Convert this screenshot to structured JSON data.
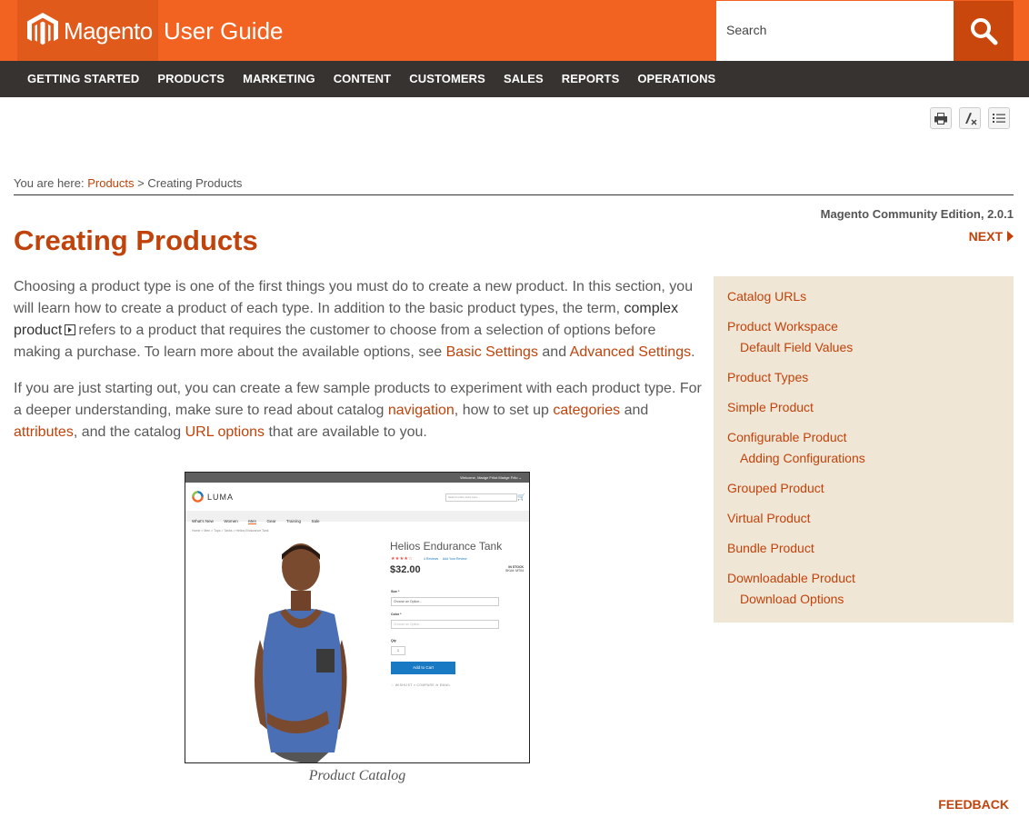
{
  "header": {
    "logo_text": "Magento",
    "guide_title": "User Guide",
    "search_placeholder": "Search",
    "brand_color": "#f26322"
  },
  "nav": {
    "items": [
      "GETTING STARTED",
      "PRODUCTS",
      "MARKETING",
      "CONTENT",
      "CUSTOMERS",
      "SALES",
      "REPORTS",
      "OPERATIONS"
    ]
  },
  "toolbar": {
    "icons": [
      "print-icon",
      "clear-highlight-icon",
      "toc-icon"
    ]
  },
  "breadcrumb": {
    "prefix": "You are here:",
    "link": "Products",
    "separator": ">",
    "current": "Creating Products"
  },
  "edition": "Magento Community Edition, 2.0.1",
  "next_label": "NEXT",
  "page_title": "Creating Products",
  "intro": {
    "p1_a": "Choosing a product type is one of the first things you must do to create a new product. In this section, you will learn how to create a product of each type. In addition to the basic product types, the term,",
    "p1_term": "complex product",
    "p1_b": "refers to a product that requires the customer to choose from a selection of options before making a purchase. To learn more about the available options, see",
    "p1_link1": "Basic Settings",
    "p1_and": "and",
    "p1_link2": "Advanced Settings",
    "p1_end": ".",
    "p2_a": "If you are just starting out, you can create a few sample products to experiment with each product type. For a deeper understanding, make sure to read about catalog",
    "p2_link1": "navigation",
    "p2_b": ", how to set up",
    "p2_link2": "categories",
    "p2_and": "and",
    "p2_link3": "attributes",
    "p2_c": ", and the catalog",
    "p2_link4": "URL options",
    "p2_d": "that are available to you."
  },
  "sidebar": {
    "items": [
      {
        "label": "Catalog URLs",
        "level": 0
      },
      {
        "label": "Product Workspace",
        "level": 0
      },
      {
        "label": "Default Field Values",
        "level": 1
      },
      {
        "label": "Product Types",
        "level": 0
      },
      {
        "label": "Simple Product",
        "level": 0
      },
      {
        "label": "Configurable Product",
        "level": 0
      },
      {
        "label": "Adding Configurations",
        "level": 1
      },
      {
        "label": "Grouped Product",
        "level": 0
      },
      {
        "label": "Virtual Product",
        "level": 0
      },
      {
        "label": "Bundle Product",
        "level": 0
      },
      {
        "label": "Downloadable Product",
        "level": 0
      },
      {
        "label": "Download Options",
        "level": 1
      }
    ]
  },
  "screenshot": {
    "topbar": "Welcome, Madge Frilot   Madge Frilo ⌄",
    "brand": "LUMA",
    "search_placeholder": "Search entire store here...",
    "menu": [
      "What's New",
      "Women",
      "Men",
      "Gear",
      "Training",
      "Sale"
    ],
    "active_menu": "Men",
    "breadcrumb": "Home  >  Men  >  Tops  >  Tanks  >  Helios Endurance Tank",
    "product_name": "Helios Endurance Tank",
    "stars": "★★★★☆",
    "rating_pct": 80,
    "reviews": "4 Reviews",
    "add_review": "Add Your Review",
    "price": "$32.00",
    "stock": "IN STOCK",
    "sku": "SKU#:  MT04",
    "size_label": "Size *",
    "size_option": "Choose an Option...",
    "color_label": "Color *",
    "color_option": "Choose an Option...",
    "qty_label": "Qty",
    "qty_value": "1",
    "add_to_cart": "Add to Cart",
    "extras": "♡ WISHLIST     ≡ COMPARE     ✉ EMAIL"
  },
  "caption": "Product Catalog",
  "feedback": "FEEDBACK"
}
